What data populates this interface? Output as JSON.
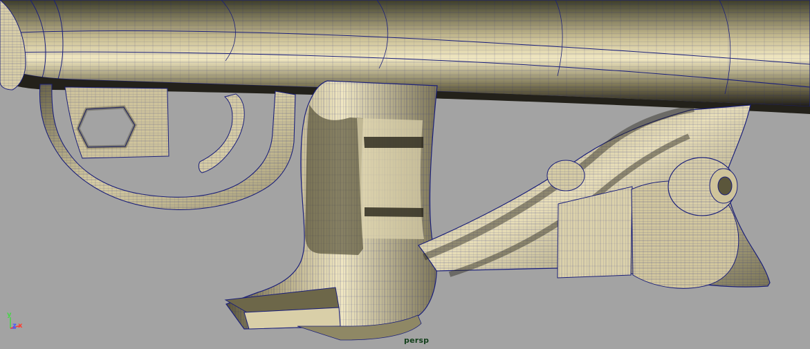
{
  "viewport": {
    "camera_label": "persp",
    "axis_labels": {
      "y": "y",
      "z": "z",
      "x": "x"
    }
  },
  "colors": {
    "background": "#a3a3a3",
    "model_fill": "#d4c9a0",
    "model_shadow": "#6f6a48",
    "model_dark": "#302d20",
    "wireframe": "#1a1f7a",
    "camera_label": "#123f1a",
    "axis_y": "#49d54a",
    "axis_z": "#4358ff",
    "axis_x": "#ff3d31"
  },
  "icons": {
    "viewport_axis": "view-axis-icon"
  }
}
